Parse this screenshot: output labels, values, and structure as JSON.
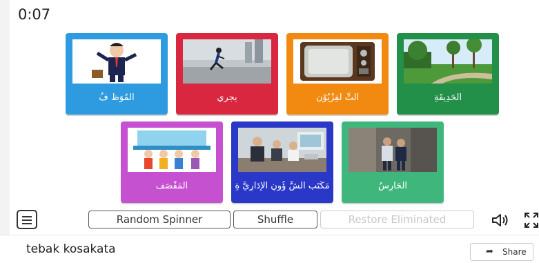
{
  "timer": "0:07",
  "cards": [
    {
      "label": "الْمُوَظَّ فُ",
      "color": "#2e9be0",
      "image": "businessman-icon"
    },
    {
      "label": "يجري",
      "color": "#d8273f",
      "image": "runner-icon"
    },
    {
      "label": "التِّ لفِزْيُوْن",
      "color": "#f28a12",
      "image": "television-icon"
    },
    {
      "label": "الْحَدِيقَةِ",
      "color": "#23904a",
      "image": "garden-icon"
    },
    {
      "label": "الْمَقْصَف",
      "color": "#c551d1",
      "image": "canteen-icon"
    },
    {
      "label": "مَكْتَب الشُّ ؤُونِ الْإدَارِيَّ ةِ",
      "color": "#2a38c8",
      "image": "office-icon"
    },
    {
      "label": "الْحَارِسُ",
      "color": "#3fb77c",
      "image": "guard-icon"
    }
  ],
  "controls": {
    "random_spinner": "Random Spinner",
    "shuffle": "Shuffle",
    "restore": "Restore Eliminated"
  },
  "footer": {
    "title": "tebak kosakata",
    "share": "Share"
  }
}
